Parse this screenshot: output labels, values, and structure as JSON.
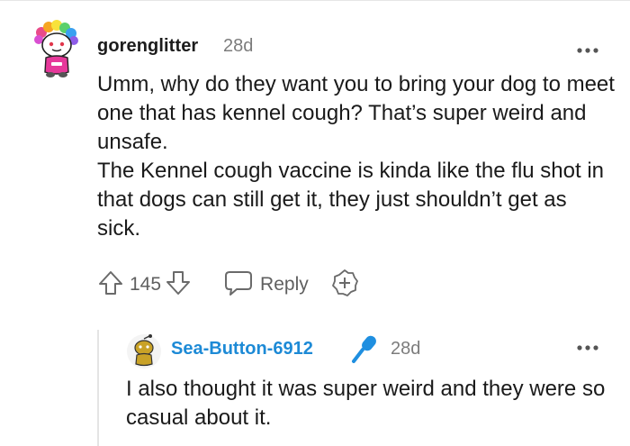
{
  "comment": {
    "author": "gorenglitter",
    "age": "28d",
    "avatar": "rainbow-hair-snoo-avatar",
    "paragraphs": [
      "Umm, why do they want you to bring your dog to meet one that has kennel cough? That’s super weird and unsafe.",
      "The Kennel cough vaccine is kinda like the flu shot in that dogs can still get it, they just shouldn’t get as sick."
    ],
    "actions": {
      "upvote_icon": "arrow-up-icon",
      "score": "145",
      "downvote_icon": "arrow-down-icon",
      "reply_icon": "speech-bubble-icon",
      "reply_label": "Reply",
      "award_icon": "plus-badge-icon"
    },
    "more_icon": "more-dots-icon"
  },
  "reply": {
    "author": "Sea-Button-6912",
    "author_color": "#1d8ad6",
    "flair_icon": "microphone-icon",
    "flair_color": "#1f8fe0",
    "age": "28d",
    "avatar": "yellow-snoo-avatar",
    "text": "I also thought it was super weird and they were so casual about it.",
    "more_icon": "more-dots-icon"
  }
}
